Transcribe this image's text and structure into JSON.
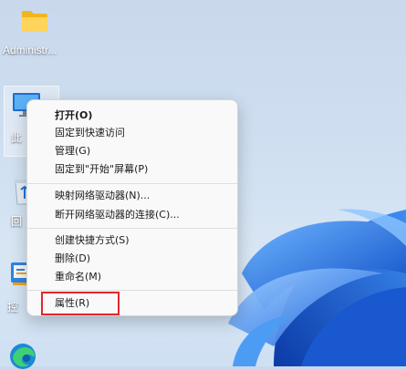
{
  "desktop": {
    "icons": [
      {
        "label": "Administr...",
        "icon": "folder-icon"
      },
      {
        "label": "此",
        "icon": "this-pc-icon"
      },
      {
        "label": "回",
        "icon": "recycle-bin-icon"
      },
      {
        "label": "控",
        "icon": "control-panel-icon"
      },
      {
        "label": "",
        "icon": "edge-icon"
      }
    ]
  },
  "context_menu": {
    "items": [
      {
        "label": "打开(O)",
        "bold": true
      },
      {
        "label": "固定到快速访问"
      },
      {
        "label": "管理(G)"
      },
      {
        "label": "固定到\"开始\"屏幕(P)"
      },
      {
        "label": "映射网络驱动器(N)..."
      },
      {
        "label": "断开网络驱动器的连接(C)..."
      },
      {
        "label": "创建快捷方式(S)"
      },
      {
        "label": "删除(D)"
      },
      {
        "label": "重命名(M)"
      },
      {
        "label": "属性(R)",
        "highlighted": true
      }
    ]
  },
  "colors": {
    "highlight_border": "#e0282e",
    "menu_background": "#f9f9f9",
    "wallpaper_blue": "#1f6fd6"
  }
}
